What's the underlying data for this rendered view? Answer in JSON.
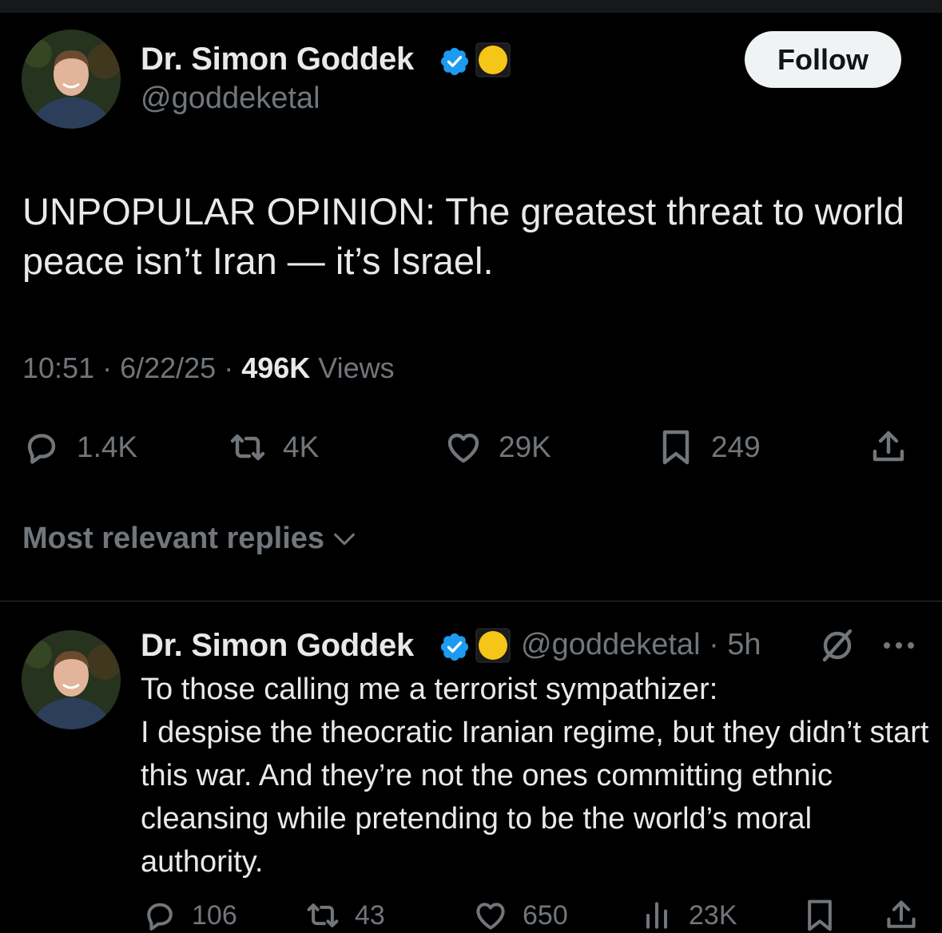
{
  "post": {
    "author_name": "Dr. Simon Goddek",
    "author_handle": "@goddeketal",
    "follow_label": "Follow",
    "text": "UNPOPULAR OPINION: The greatest threat to world peace isn’t Iran — it’s Israel.",
    "time": "10:51",
    "date": "6/22/25",
    "views_count": "496K",
    "views_label": "Views",
    "stats": {
      "replies": "1.4K",
      "reposts": "4K",
      "likes": "29K",
      "bookmarks": "249"
    }
  },
  "replies_filter": {
    "label": "Most relevant replies"
  },
  "reply": {
    "author_name": "Dr. Simon Goddek",
    "author_handle": "@goddeketal",
    "age": "5h",
    "text": "To those calling me a terrorist sympathizer:\nI despise the theocratic Iranian regime, but they didn’t start this war. And they’re not the ones committing ethnic cleansing while pretending to be the world’s moral authority.",
    "stats": {
      "replies": "106",
      "reposts": "43",
      "likes": "650",
      "views": "23K"
    }
  },
  "colors": {
    "background": "#000000",
    "text": "#e7e9ea",
    "muted": "#71767b",
    "verified": "#1d9bf0",
    "follow_bg": "#eff3f4"
  },
  "icons": [
    "reply-icon",
    "repost-icon",
    "like-icon",
    "bookmark-icon",
    "share-icon",
    "verified-badge-icon",
    "yellow-circle-emoji",
    "chevron-down-icon",
    "grok-icon",
    "more-icon",
    "views-icon"
  ]
}
